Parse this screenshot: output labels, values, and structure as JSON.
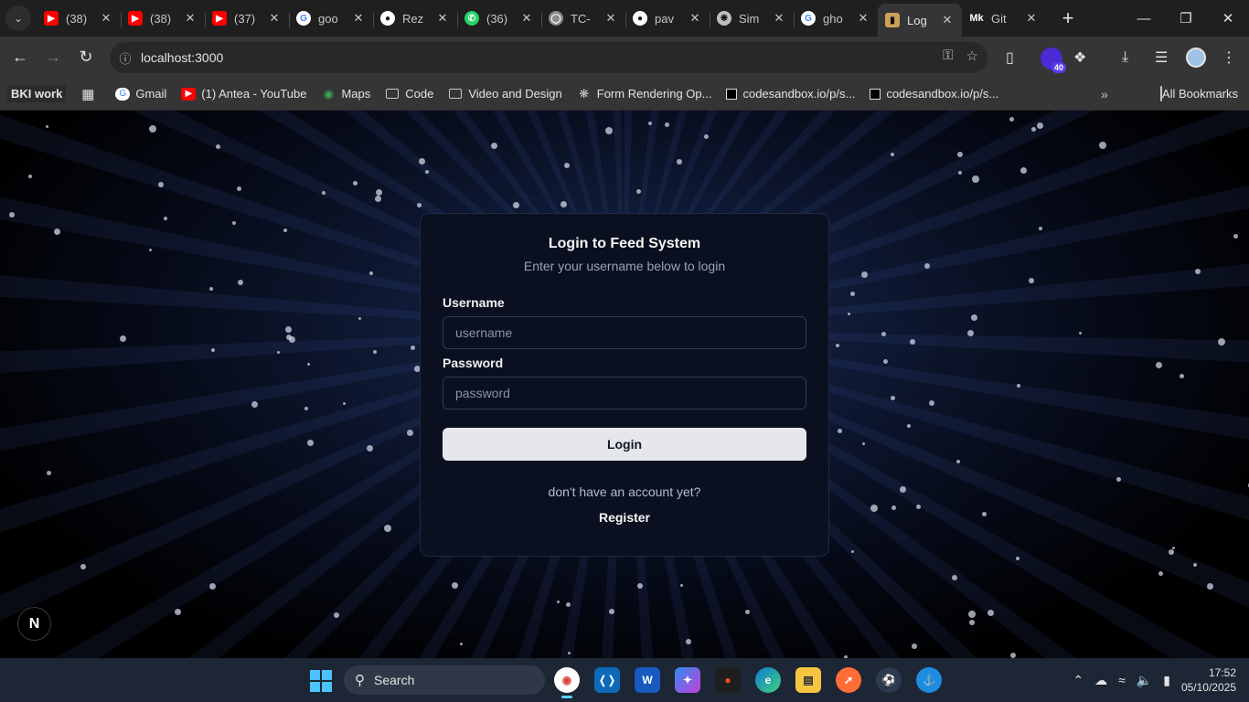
{
  "browser": {
    "tabs": [
      {
        "title": "(38)",
        "favicon": "youtube-icon",
        "active": false
      },
      {
        "title": "(38)",
        "favicon": "youtube-icon",
        "active": false
      },
      {
        "title": "(37)",
        "favicon": "youtube-icon",
        "active": false
      },
      {
        "title": "goo",
        "favicon": "google-icon",
        "active": false
      },
      {
        "title": "Rez",
        "favicon": "github-icon",
        "active": false
      },
      {
        "title": "(36)",
        "favicon": "whatsapp-icon",
        "active": false
      },
      {
        "title": "TC-",
        "favicon": "globe-icon",
        "active": false
      },
      {
        "title": "pav",
        "favicon": "github-icon",
        "active": false
      },
      {
        "title": "Sim",
        "favicon": "openai-icon",
        "active": false
      },
      {
        "title": "gho",
        "favicon": "google-icon",
        "active": false
      },
      {
        "title": "Log",
        "favicon": "lock-icon",
        "active": true
      },
      {
        "title": "Git",
        "favicon": "mk-icon",
        "active": false
      }
    ],
    "url": "localhost:3000",
    "extension_badge": "40",
    "bookmarks": [
      {
        "label": "BKI work",
        "icon": "none"
      },
      {
        "label": "Gmail",
        "icon": "google-icon"
      },
      {
        "label": "(1) Antea - YouTube",
        "icon": "youtube-icon"
      },
      {
        "label": "Maps",
        "icon": "maps-icon"
      },
      {
        "label": "Code",
        "icon": "folder-icon"
      },
      {
        "label": "Video and Design",
        "icon": "folder-icon"
      },
      {
        "label": "Form Rendering Op...",
        "icon": "openai-icon"
      },
      {
        "label": "codesandbox.io/p/s...",
        "icon": "codesandbox-icon"
      },
      {
        "label": "codesandbox.io/p/s...",
        "icon": "codesandbox-icon"
      }
    ],
    "all_bookmarks": "All Bookmarks"
  },
  "login": {
    "title": "Login to Feed System",
    "subtitle": "Enter your username below to login",
    "username_label": "Username",
    "username_placeholder": "username",
    "password_label": "Password",
    "password_placeholder": "password",
    "login_button": "Login",
    "no_account": "don't have an account yet?",
    "register": "Register"
  },
  "next_badge": "N",
  "taskbar": {
    "search_label": "Search",
    "time": "17:52",
    "date": "05/10/2025"
  },
  "colors": {
    "card_bg": "#0b1020",
    "button_bg": "#e5e7eb",
    "taskbar_bg": "#1c2634"
  }
}
